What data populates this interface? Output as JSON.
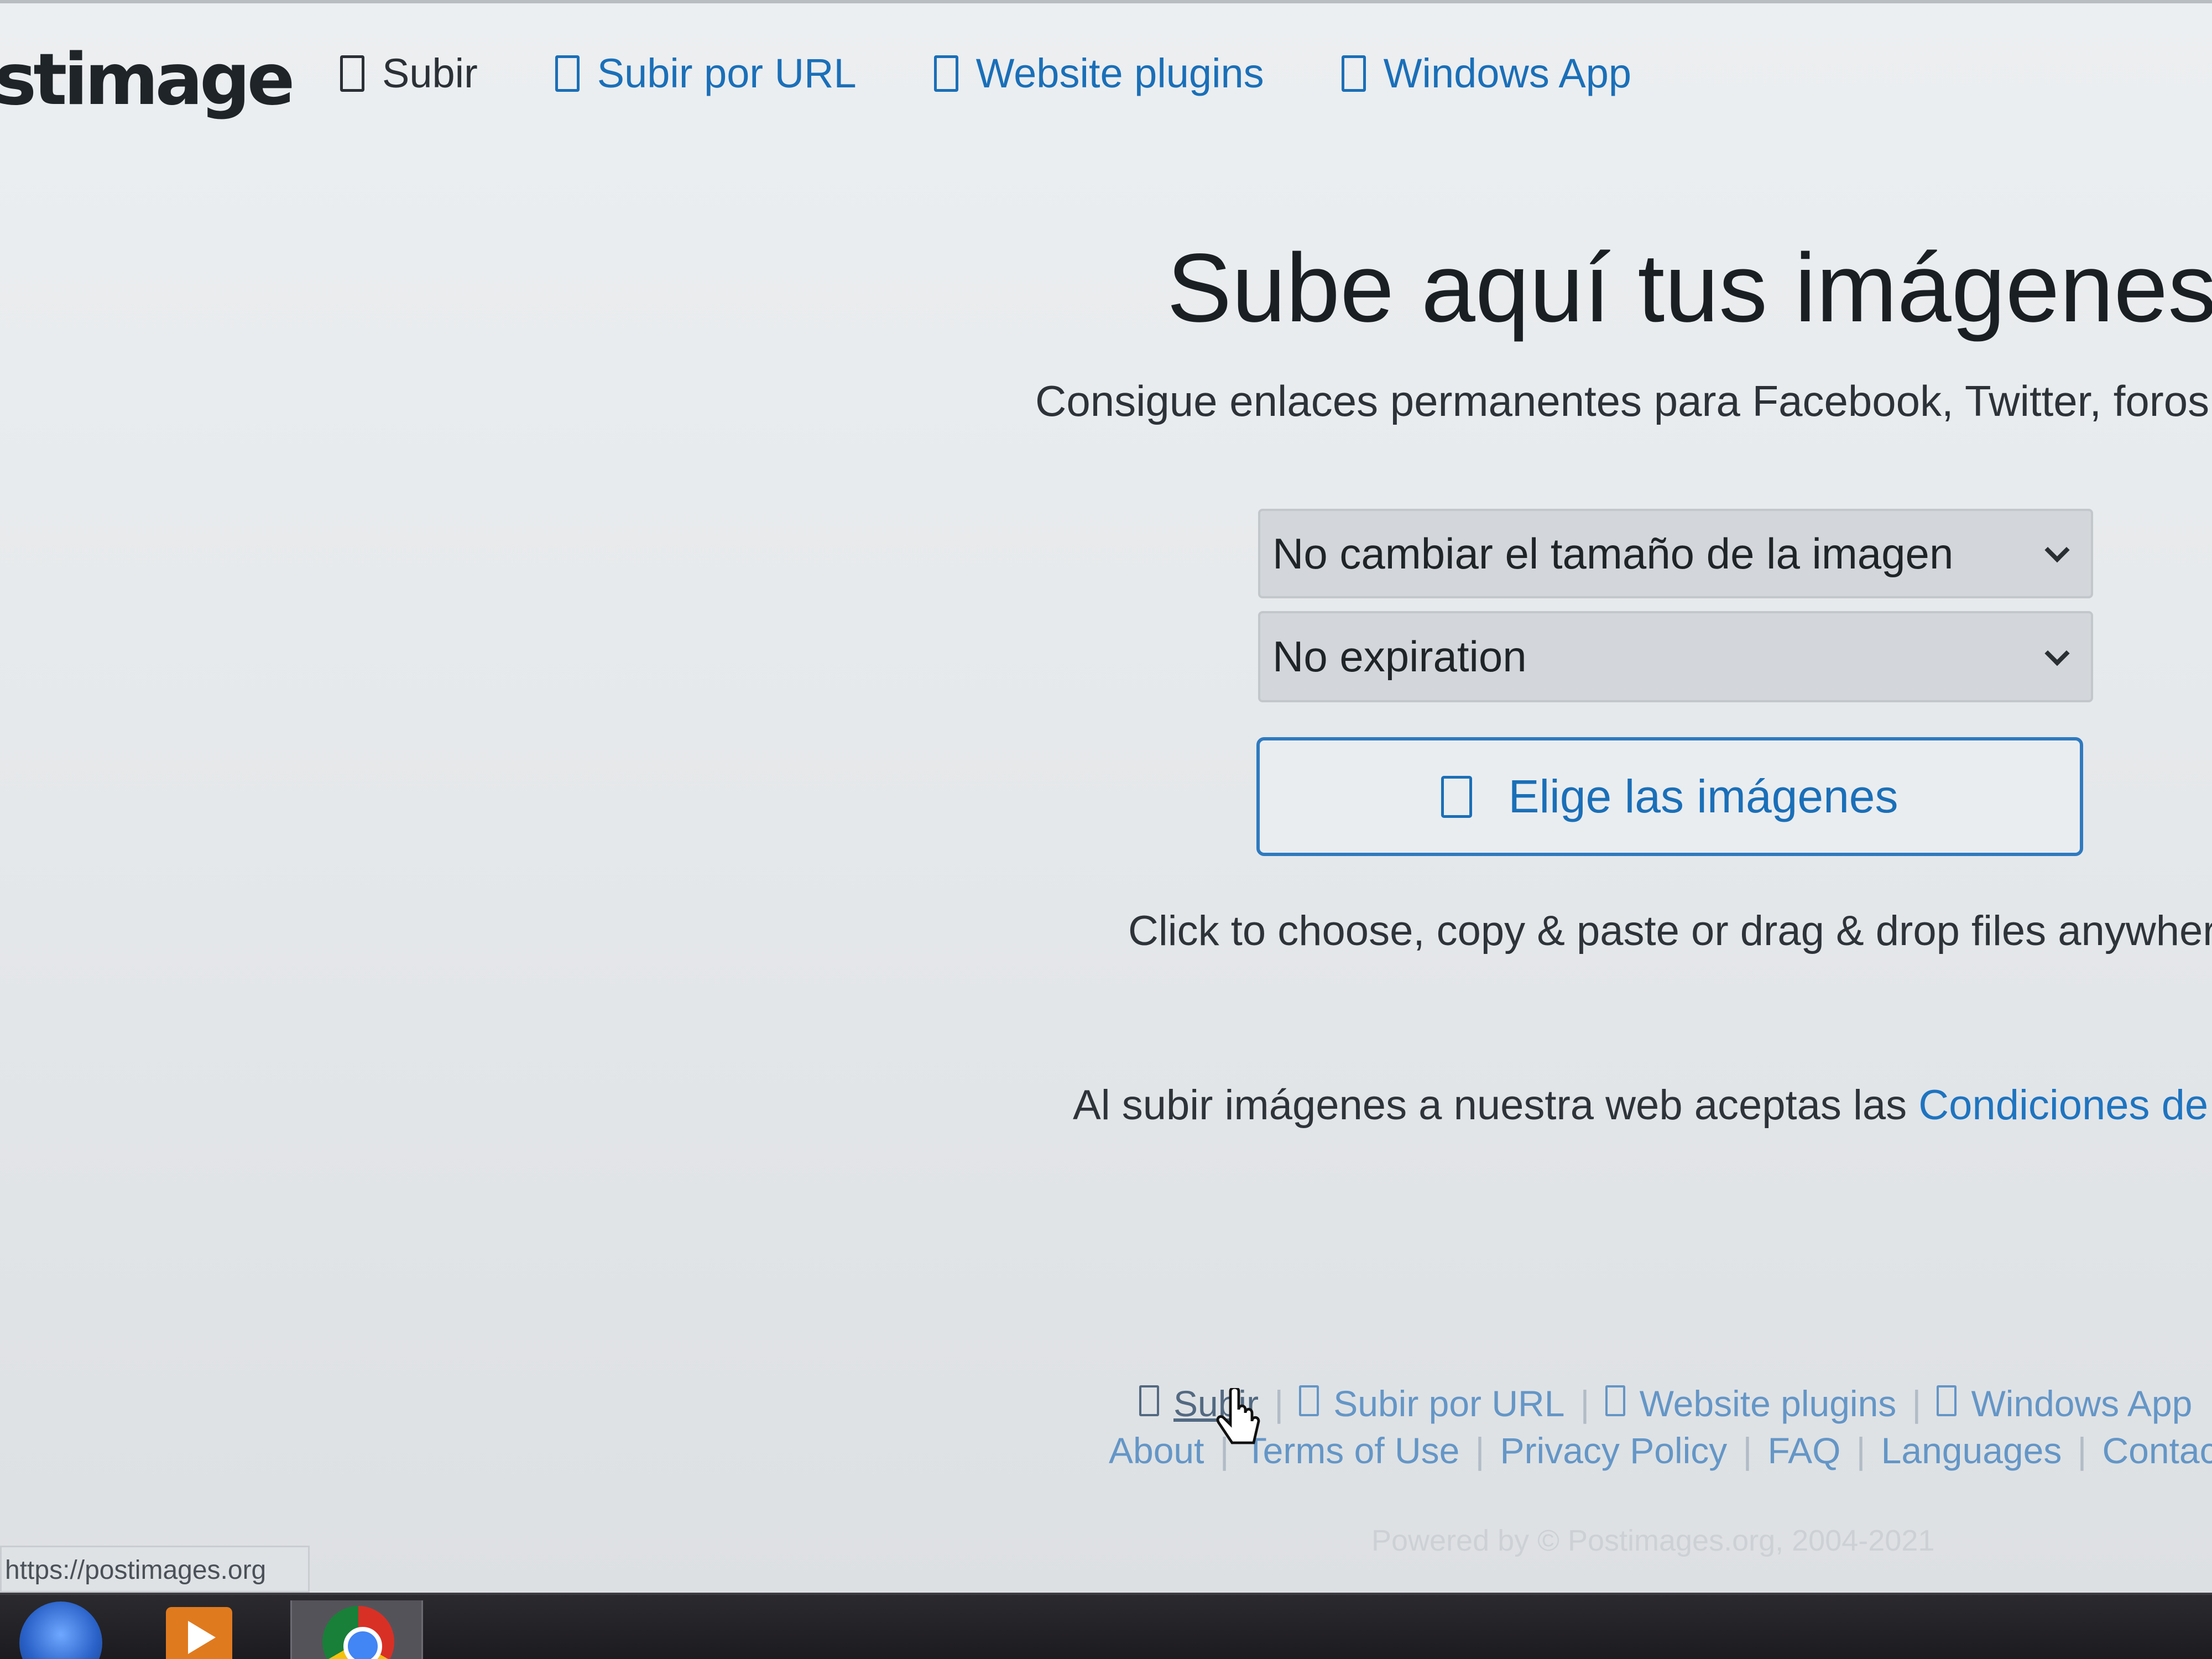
{
  "header": {
    "brand": "stimage",
    "nav": [
      {
        "label": "Subir"
      },
      {
        "label": "Subir por URL"
      },
      {
        "label": "Website plugins"
      },
      {
        "label": "Windows App"
      }
    ]
  },
  "hero": {
    "title": "Sube aquí tus imágenes",
    "subtitle": "Consigue enlaces permanentes para Facebook, Twitter, foros y"
  },
  "form": {
    "resize_select": {
      "selected": "No cambiar el tamaño de la imagen"
    },
    "expiration_select": {
      "selected": "No expiration"
    },
    "choose_button": "Elige las imágenes",
    "hint": "Click to choose, copy & paste or drag & drop files anywhere",
    "terms_prefix": "Al subir imágenes a nuestra web aceptas las ",
    "terms_link": "Condiciones de us"
  },
  "footer": {
    "row1": [
      {
        "label": "Subir"
      },
      {
        "label": "Subir por URL"
      },
      {
        "label": "Website plugins"
      },
      {
        "label": "Windows App"
      }
    ],
    "row2": [
      "About",
      "Terms of Use",
      "Privacy Policy",
      "FAQ",
      "Languages",
      "Contact us"
    ],
    "powered": "Powered by © Postimages.org, 2004-2021"
  },
  "status_bar": {
    "url": "https://postimages.org"
  },
  "taskbar": {
    "icons": [
      "windows-start-icon",
      "media-player-icon",
      "chrome-icon"
    ]
  },
  "colors": {
    "link": "#1a6fb8",
    "button_border": "#2e7ac0",
    "taskbar": "#1c1b1f"
  }
}
